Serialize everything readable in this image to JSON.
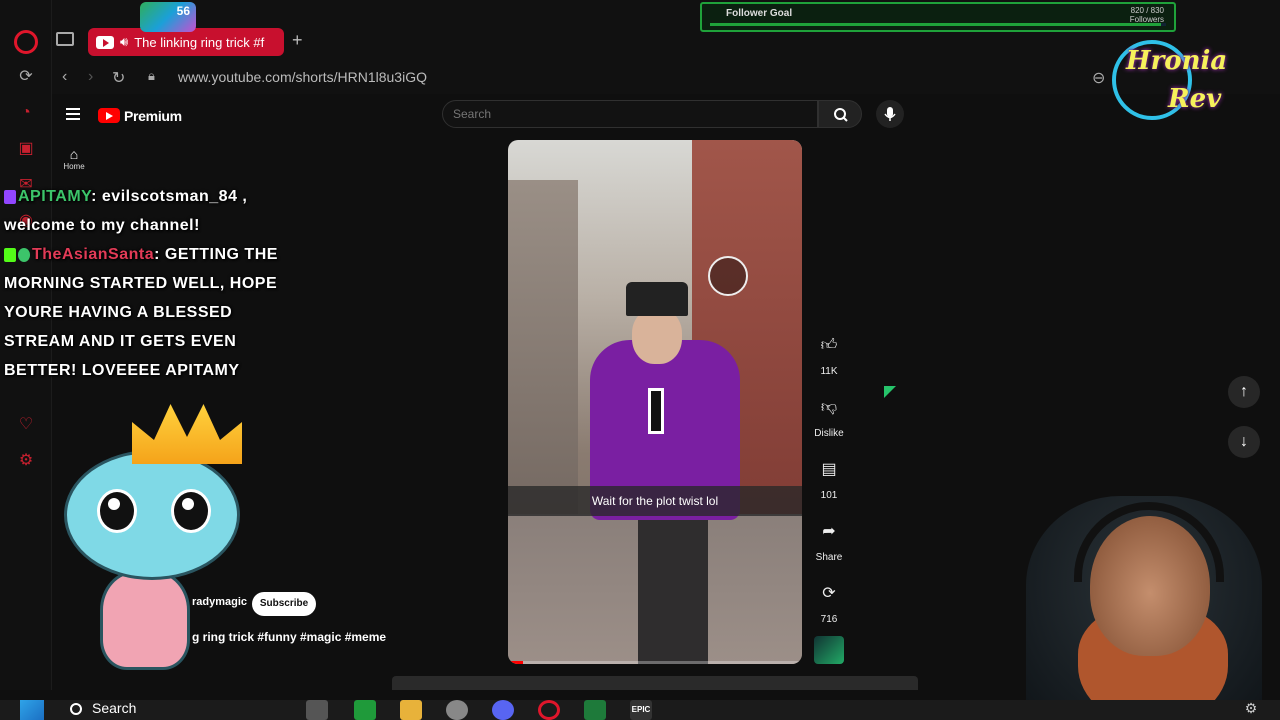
{
  "browser": {
    "tab_title": "The linking ring trick #f",
    "url": "www.youtube.com/shorts/HRN1l8u3iGQ",
    "emote_count": "56"
  },
  "follower_goal": {
    "label": "Follower Goal",
    "count": "820 / 830",
    "count_label": "Followers",
    "progress": 0.988
  },
  "youtube": {
    "brand": "Premium",
    "search_placeholder": "Search",
    "home_label": "Home",
    "short": {
      "caption": "Wait for the plot twist lol",
      "channel": "radymagic",
      "subscribe_label": "Subscribe",
      "title": "g ring trick #funny #magic #meme",
      "progress": 0.05
    },
    "actions": {
      "like_count": "11K",
      "dislike_label": "Dislike",
      "comment_count": "101",
      "share_label": "Share",
      "remix_count": "716"
    }
  },
  "chat": [
    {
      "user": "APITAMY",
      "text": ": evilscotsman_84 , welcome to my channel!"
    },
    {
      "user": "TheAsianSanta",
      "text": ": GETTING THE MORNING STARTED WELL, HOPE YOURE HAVING A BLESSED STREAM AND IT GETS EVEN BETTER! LOVEEEE APITAMY"
    }
  ],
  "stream_logo": {
    "line1": "Hronia",
    "line2": "Rev"
  },
  "taskbar": {
    "search_label": "Search"
  },
  "colors": {
    "accent": "#c8102e",
    "chat_user_1": "#3cc46a",
    "chat_user_2": "#e33b57",
    "goal_green": "#1fa23a"
  }
}
